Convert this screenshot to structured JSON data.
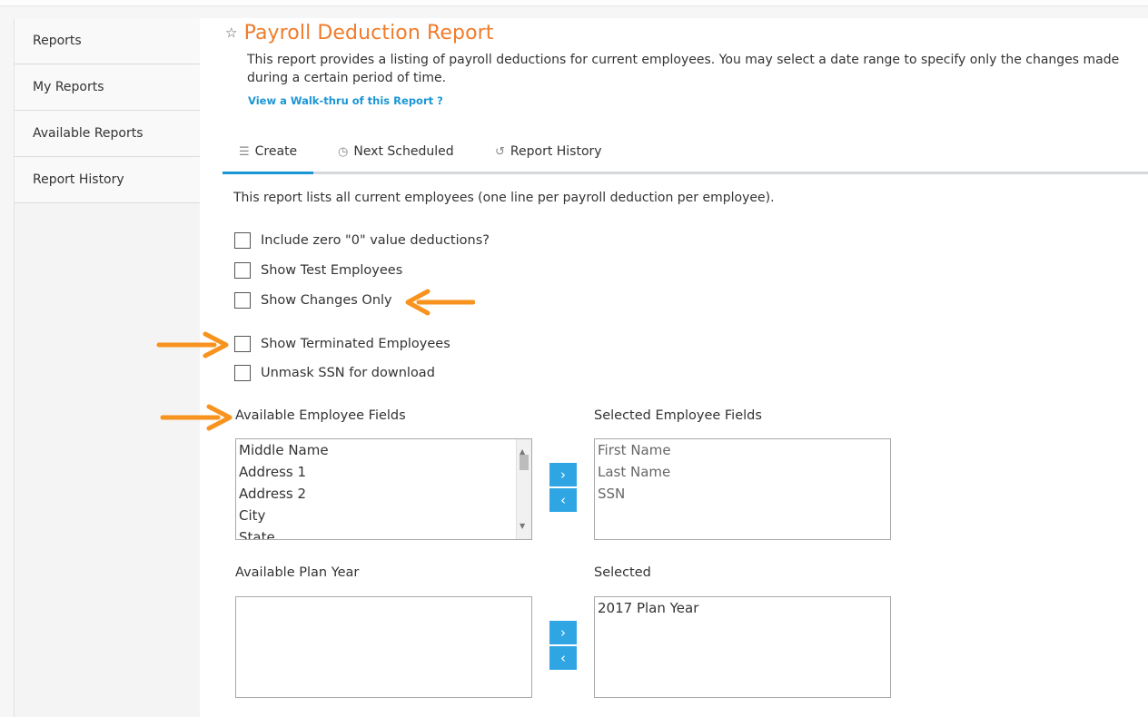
{
  "sidebar": {
    "items": [
      {
        "label": "Reports"
      },
      {
        "label": "My Reports"
      },
      {
        "label": "Available Reports"
      },
      {
        "label": "Report History"
      }
    ]
  },
  "header": {
    "star_icon": "☆",
    "title": "Payroll Deduction Report",
    "description": "This report provides a listing of payroll deductions for current employees. You may select a date range to specify only the changes made during a certain period of time.",
    "walkthru_link": "View a Walk-thru of this Report ?"
  },
  "tabs": [
    {
      "icon": "list-icon",
      "glyph": "☰",
      "label": "Create",
      "active": true
    },
    {
      "icon": "clock-icon",
      "glyph": "◷",
      "label": "Next Scheduled",
      "active": false
    },
    {
      "icon": "history-icon",
      "glyph": "↺",
      "label": "Report History",
      "active": false
    }
  ],
  "create": {
    "intro": "This report lists all current employees (one line per payroll deduction per employee).",
    "checkboxes": [
      {
        "label": "Include zero \"0\" value deductions?",
        "checked": false
      },
      {
        "label": "Show Test Employees",
        "checked": false
      },
      {
        "label": "Show Changes Only",
        "checked": false
      },
      {
        "label": "Show Terminated Employees",
        "checked": false
      },
      {
        "label": "Unmask SSN for download",
        "checked": false
      }
    ],
    "employee_fields": {
      "available_label": "Available Employee Fields",
      "selected_label": "Selected Employee Fields",
      "available": [
        "Middle Name",
        "Address 1",
        "Address 2",
        "City",
        "State"
      ],
      "selected": [
        "First Name",
        "Last Name",
        "SSN"
      ]
    },
    "plan_year": {
      "available_label": "Available Plan Year",
      "selected_label": "Selected",
      "available": [],
      "selected": [
        "2017 Plan Year"
      ]
    },
    "move_right": "›",
    "move_left": "‹"
  },
  "colors": {
    "accent_orange": "#f07c2b",
    "link_blue": "#1a96d5",
    "button_blue": "#2fa6e3",
    "annotation_arrow": "#f7931e"
  }
}
